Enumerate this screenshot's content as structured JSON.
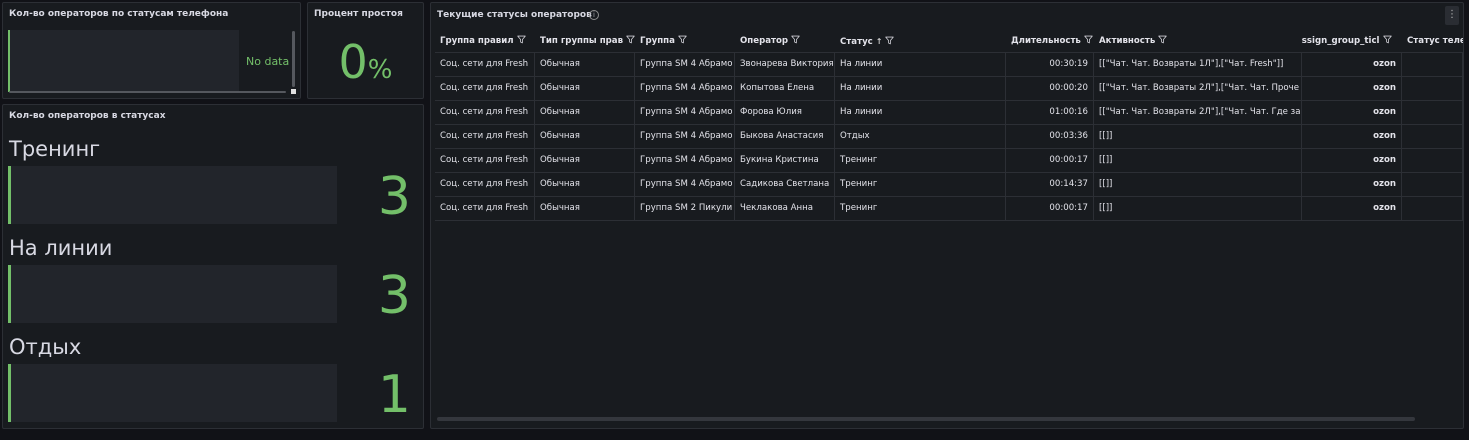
{
  "phone_status_panel": {
    "title": "Кол-во операторов по статусам телефона",
    "no_data": "No data"
  },
  "idle_panel": {
    "title": "Процент простоя",
    "value": "0",
    "unit": "%"
  },
  "status_count_panel": {
    "title": "Кол-во операторов в статусах",
    "stats": [
      {
        "label": "Тренинг",
        "value": "3"
      },
      {
        "label": "На линии",
        "value": "3"
      },
      {
        "label": "Отдых",
        "value": "1"
      }
    ]
  },
  "table_panel": {
    "title": "Текущие статусы операторов",
    "info_icon": "i",
    "menu_icon": "⋮",
    "columns": [
      "Группа правил",
      "Тип группы прав",
      "Группа",
      "Оператор",
      "Статус",
      "Длительность",
      "Активность",
      "assign_group_ticl",
      "Статус теле"
    ],
    "sort_indicator": "↑",
    "rows": [
      [
        "Соц. сети для Fresh",
        "Обычная",
        "Группа SM 4 Абрамо",
        "Звонарева Виктория",
        "На линии",
        "00:30:19",
        "[[\"Чат. Чат. Возвраты 1Л\"],[\"Чат. Fresh\"]]",
        "ozon",
        ""
      ],
      [
        "Соц. сети для Fresh",
        "Обычная",
        "Группа SM 4 Абрамо",
        "Копытова Елена",
        "На линии",
        "00:00:20",
        "[[\"Чат. Чат. Возвраты 2Л\"],[\"Чат. Чат. Проче",
        "ozon",
        ""
      ],
      [
        "Соц. сети для Fresh",
        "Обычная",
        "Группа SM 4 Абрамо",
        "Форова Юлия",
        "На линии",
        "01:00:16",
        "[[\"Чат. Чат. Возвраты 2Л\"],[\"Чат. Чат. Где за",
        "ozon",
        ""
      ],
      [
        "Соц. сети для Fresh",
        "Обычная",
        "Группа SM 4 Абрамо",
        "Быкова Анастасия",
        "Отдых",
        "00:03:36",
        "[[]]",
        "ozon",
        ""
      ],
      [
        "Соц. сети для Fresh",
        "Обычная",
        "Группа SM 4 Абрамо",
        "Букина Кристина",
        "Тренинг",
        "00:00:17",
        "[[]]",
        "ozon",
        ""
      ],
      [
        "Соц. сети для Fresh",
        "Обычная",
        "Группа SM 4 Абрамо",
        "Садикова Светлана",
        "Тренинг",
        "00:14:37",
        "[[]]",
        "ozon",
        ""
      ],
      [
        "Соц. сети для Fresh",
        "Обычная",
        "Группа SM 2 Пикули",
        "Чеклакова Анна",
        "Тренинг",
        "00:00:17",
        "[[]]",
        "ozon",
        ""
      ]
    ]
  },
  "colors": {
    "accent": "#73bf69",
    "panel_bg": "#181b1f",
    "page_bg": "#111217"
  }
}
